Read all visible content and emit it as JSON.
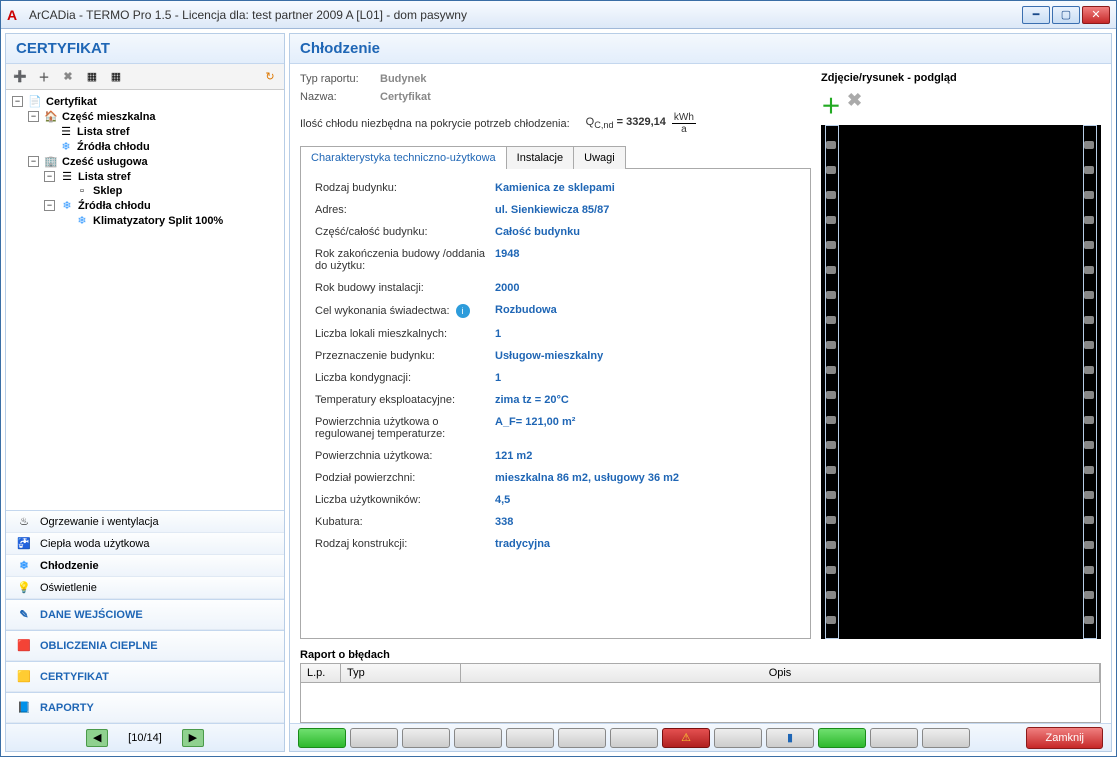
{
  "window": {
    "title": "ArCADia - TERMO Pro 1.5 - Licencja dla: test partner 2009 A [L01] - dom pasywny"
  },
  "left": {
    "panel_title": "CERTYFIKAT",
    "tree": {
      "root": "Certyfikat",
      "n1": "Część mieszkalna",
      "n1a": "Lista stref",
      "n1b": "Źródła chłodu",
      "n2": "Cześć usługowa",
      "n2a": "Lista stref",
      "n2a1": "Sklep",
      "n2b": "Źródła chłodu",
      "n2b1": "Klimatyzatory Split 100%"
    },
    "nav": {
      "i0": "Ogrzewanie i wentylacja",
      "i1": "Ciepła woda użytkowa",
      "i2": "Chłodzenie",
      "i3": "Oświetlenie"
    },
    "big": {
      "b0": "DANE WEJŚCIOWE",
      "b1": "OBLICZENIA CIEPLNE",
      "b2": "CERTYFIKAT",
      "b3": "RAPORTY"
    },
    "pager": "[10/14]"
  },
  "main": {
    "title": "Chłodzenie",
    "row_type_label": "Typ raportu:",
    "row_type_value": "Budynek",
    "row_name_label": "Nazwa:",
    "row_name_value": "Certyfikat",
    "formula_label": "Ilość chłodu niezbędna na pokrycie potrzeb chłodzenia:",
    "formula_sym": "Q",
    "formula_sub": "C,nd",
    "formula_eq": "= 3329,14",
    "formula_unit_top": "kWh",
    "formula_unit_bot": "a",
    "tabs": {
      "t0": "Charakterystyka techniczno-użytkowa",
      "t1": "Instalacje",
      "t2": "Uwagi"
    },
    "props": [
      {
        "label": "Rodzaj budynku:",
        "value": "Kamienica ze sklepami"
      },
      {
        "label": "Adres:",
        "value": "ul. Sienkiewicza 85/87"
      },
      {
        "label": "Część/całość budynku:",
        "value": "Całość budynku"
      },
      {
        "label": "Rok zakończenia budowy /oddania do użytku:",
        "value": "1948"
      },
      {
        "label": "Rok budowy instalacji:",
        "value": "2000"
      },
      {
        "label": "Cel wykonania świadectwa:",
        "value": "Rozbudowa",
        "info": true
      },
      {
        "label": "Liczba lokali mieszkalnych:",
        "value": "1"
      },
      {
        "label": "Przeznaczenie budynku:",
        "value": "Usługow-mieszkalny"
      },
      {
        "label": "Liczba kondygnacji:",
        "value": "1"
      },
      {
        "label": "Temperatury eksploatacyjne:",
        "value": "zima tz = 20°C"
      },
      {
        "label": "Powierzchnia użytkowa o regulowanej temperaturze:",
        "value": "A_F= 121,00 m²"
      },
      {
        "label": "Powierzchnia użytkowa:",
        "value": "121 m2"
      },
      {
        "label": "Podział powierzchni:",
        "value": "mieszkalna 86 m2, usługowy 36 m2"
      },
      {
        "label": "Liczba użytkowników:",
        "value": "4,5"
      },
      {
        "label": "Kubatura:",
        "value": "338"
      },
      {
        "label": "Rodzaj konstrukcji:",
        "value": "tradycyjna"
      }
    ]
  },
  "side": {
    "title": "Zdjęcie/rysunek - podgląd"
  },
  "errors": {
    "title": "Raport o błędach",
    "col_lp": "L.p.",
    "col_typ": "Typ",
    "col_opis": "Opis"
  },
  "footer": {
    "close": "Zamknij"
  }
}
